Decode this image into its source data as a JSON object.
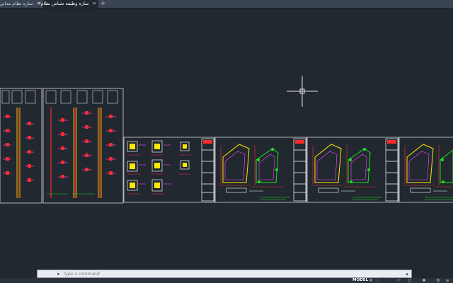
{
  "tabs": [
    {
      "label": "سازه نظام مدانی*",
      "close": "✕"
    },
    {
      "label": "سازه وظیفه شناس نظام*",
      "close": "✕"
    }
  ],
  "new_tab": "+",
  "command": {
    "placeholder": "Type a command"
  },
  "status": {
    "model": "MODEL"
  },
  "colors": {
    "background": "#212830",
    "crosshair": "#e6e6e6",
    "frame": "#d9d9d9",
    "red": "#ff2a2a",
    "yellow": "#ffe600",
    "green": "#20e020",
    "magenta": "#ff40ff",
    "cyan": "#00e0ff"
  },
  "icons": [
    "close-icon",
    "plus-icon",
    "crosshair-icon",
    "command-icon",
    "search-icon",
    "model-space-icon"
  ]
}
